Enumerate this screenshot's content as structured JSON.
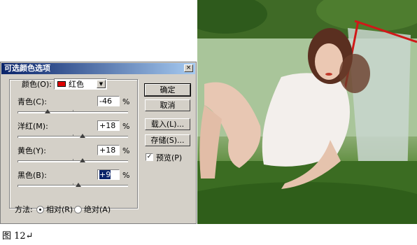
{
  "dialog": {
    "title": "可选颜色选项",
    "close_glyph": "×",
    "color_label": "颜色(O):",
    "color_value": "红色",
    "color_swatch": "#e00000",
    "sliders": [
      {
        "label": "青色(C):",
        "value": "-46",
        "unit": "%",
        "level": 0.27
      },
      {
        "label": "洋红(M):",
        "value": "+18",
        "unit": "%",
        "level": 0.59
      },
      {
        "label": "黄色(Y):",
        "value": "+18",
        "unit": "%",
        "level": 0.59
      },
      {
        "label": "黑色(B):",
        "value": "+9",
        "unit": "%",
        "level": 0.55
      }
    ],
    "buttons": {
      "ok": "确定",
      "cancel": "取消",
      "load": "载入(L)...",
      "save": "存储(S)..."
    },
    "preview": {
      "label": "预览(P)",
      "checked": true,
      "check_glyph": "✓"
    },
    "method": {
      "label": "方法:",
      "relative": "相对(R)",
      "absolute": "绝对(A)",
      "selected": "relative"
    }
  },
  "photo": {
    "icon": "photo-of-woman-in-garden"
  },
  "caption": "图 12↵"
}
